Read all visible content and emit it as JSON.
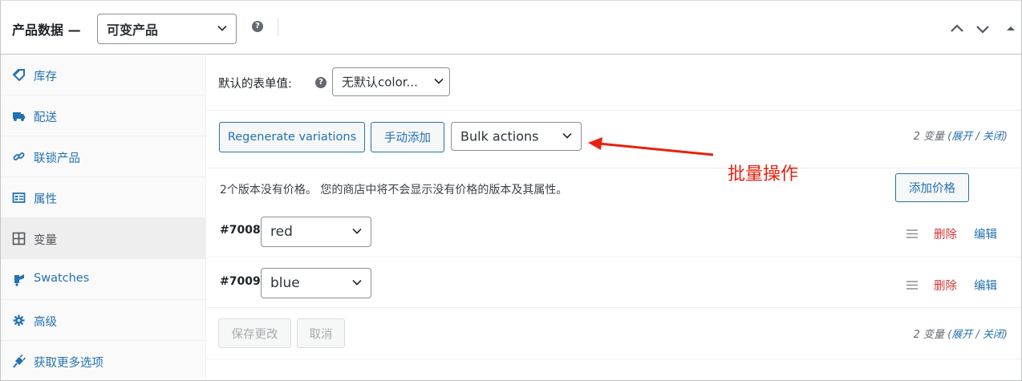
{
  "header": {
    "title": "产品数据 —",
    "product_type": "可变产品"
  },
  "sidebar": {
    "items": [
      {
        "label": "库存",
        "icon": "inventory-tag-icon"
      },
      {
        "label": "配送",
        "icon": "truck-icon"
      },
      {
        "label": "联锁产品",
        "icon": "link-icon"
      },
      {
        "label": "属性",
        "icon": "attributes-card-icon"
      },
      {
        "label": "变量",
        "icon": "grid-icon"
      },
      {
        "label": "Swatches",
        "icon": "swatches-icon"
      },
      {
        "label": "高级",
        "icon": "gear-icon"
      },
      {
        "label": "获取更多选项",
        "icon": "plugin-icon"
      }
    ],
    "active_index": 4
  },
  "defaults": {
    "label": "默认的表单值:",
    "select_value": "无默认color..."
  },
  "toolbar": {
    "regenerate_label": "Regenerate variations",
    "manual_add_label": "手动添加",
    "bulk_actions_value": "Bulk actions",
    "count_prefix": "2 变量 (",
    "expand_label": "展开",
    "sep": " / ",
    "collapse_label": "关闭",
    "count_suffix": ")"
  },
  "notice": {
    "text": "2个版本没有价格。 您的商店中将不会显示没有价格的版本及其属性。",
    "add_price_label": "添加价格"
  },
  "variations": [
    {
      "id": "#7008",
      "value": "red",
      "delete_label": "删除",
      "edit_label": "编辑"
    },
    {
      "id": "#7009",
      "value": "blue",
      "delete_label": "删除",
      "edit_label": "编辑"
    }
  ],
  "footer": {
    "save_label": "保存更改",
    "cancel_label": "取消"
  },
  "annotation": {
    "text": "批量操作",
    "color": "#e8210f"
  },
  "colors": {
    "link": "#2271b1",
    "delete": "#d63638"
  }
}
